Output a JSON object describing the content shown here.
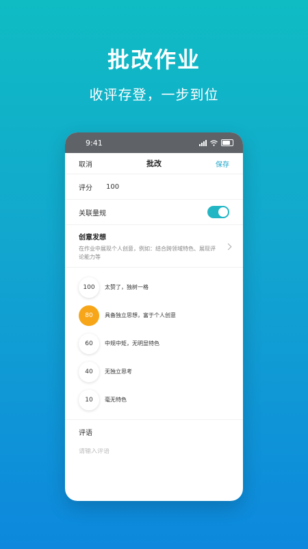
{
  "promo": {
    "headline": "批改作业",
    "subline": "收评存登，一步到位"
  },
  "statusbar": {
    "time": "9:41",
    "icons": [
      "signal-icon",
      "wifi-icon",
      "battery-icon"
    ]
  },
  "navbar": {
    "cancel": "取消",
    "title": "批改",
    "save": "保存"
  },
  "score": {
    "label": "评分",
    "value": "100"
  },
  "rubric_link": {
    "label": "关联量规",
    "enabled": true
  },
  "criteria": {
    "title": "创意发想",
    "description": "在作业中展现个人创意，例如：结合跨领域特色、展现评论能力等"
  },
  "levels": [
    {
      "score": "100",
      "text": "太赞了，独树一格",
      "selected": false
    },
    {
      "score": "80",
      "text": "具备独立思想，富于个人创意",
      "selected": true
    },
    {
      "score": "60",
      "text": "中规中矩，无明显特色",
      "selected": false
    },
    {
      "score": "40",
      "text": "无独立思考",
      "selected": false
    },
    {
      "score": "10",
      "text": "毫无特色",
      "selected": false
    }
  ],
  "comment": {
    "label": "评语",
    "placeholder": "请输入评语"
  },
  "colors": {
    "accent": "#22b6c4",
    "selected": "#f7a619",
    "save": "#1aa3c8"
  }
}
